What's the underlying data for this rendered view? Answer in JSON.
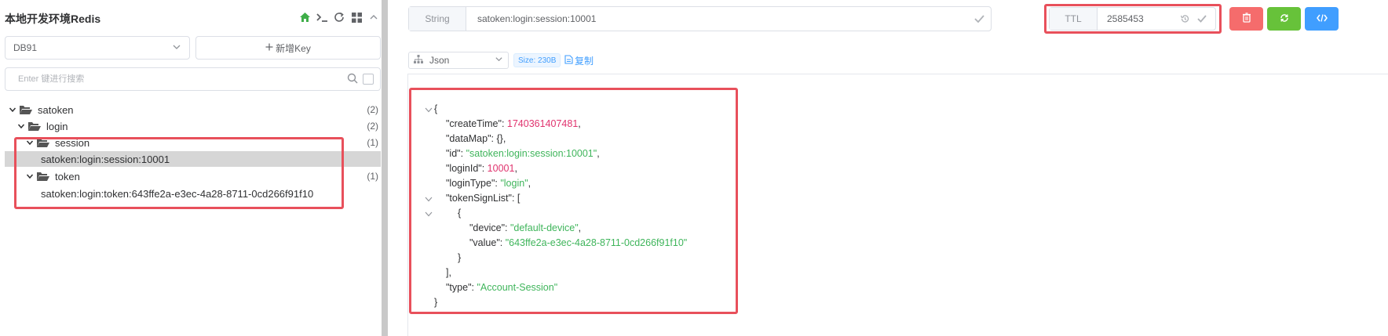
{
  "sidebar": {
    "title": "本地开发环境Redis",
    "db_select": "DB91",
    "new_key_label": "新增Key",
    "search_placeholder": "Enter 键进行搜索",
    "tree": [
      {
        "label": "satoken",
        "count": "(2)",
        "level": 0,
        "type": "folder"
      },
      {
        "label": "login",
        "count": "(2)",
        "level": 1,
        "type": "folder"
      },
      {
        "label": "session",
        "count": "(1)",
        "level": 2,
        "type": "folder"
      },
      {
        "label": "satoken:login:session:10001",
        "count": "",
        "level": 3,
        "type": "key",
        "selected": true
      },
      {
        "label": "token",
        "count": "(1)",
        "level": 2,
        "type": "folder"
      },
      {
        "label": "satoken:login:token:643ffe2a-e3ec-4a28-8711-0cd266f91f10",
        "count": "",
        "level": 3,
        "type": "key"
      }
    ]
  },
  "key_bar": {
    "type": "String",
    "key": "satoken:login:session:10001",
    "ttl_label": "TTL",
    "ttl_value": "2585453"
  },
  "viewer": {
    "format": "Json",
    "size": "Size: 230B",
    "copy_label": "复制",
    "json": {
      "open": "{",
      "createTime_key": "\"createTime\"",
      "createTime_val": "1740361407481",
      "dataMap_key": "\"dataMap\"",
      "dataMap_val": "{},",
      "id_key": "\"id\"",
      "id_val": "\"satoken:login:session:10001\"",
      "loginId_key": "\"loginId\"",
      "loginId_val": "10001",
      "loginType_key": "\"loginType\"",
      "loginType_val": "\"login\"",
      "tokenSignList_key": "\"tokenSignList\"",
      "tokenSignList_val": "[",
      "inner_open": "{",
      "device_key": "\"device\"",
      "device_val": "\"default-device\"",
      "value_key": "\"value\"",
      "value_val": "\"643ffe2a-e3ec-4a28-8711-0cd266f91f10\"",
      "inner_close": "}",
      "list_close": "],",
      "type_key": "\"type\"",
      "type_val": "\"Account-Session\"",
      "close": "}"
    }
  },
  "colors": {
    "highlight_box": "#e8505b",
    "delete_btn": "#f56c6c",
    "refresh_btn": "#67c23a",
    "code_btn": "#409eff",
    "json_string": "#3fb55b",
    "json_number": "#e0336e"
  },
  "icons": {
    "header": [
      "home-icon",
      "terminal-icon",
      "refresh-icon",
      "grid-icon",
      "chevron-up-icon"
    ],
    "buttons": [
      "trash-icon",
      "refresh-icon",
      "code-icon"
    ]
  }
}
